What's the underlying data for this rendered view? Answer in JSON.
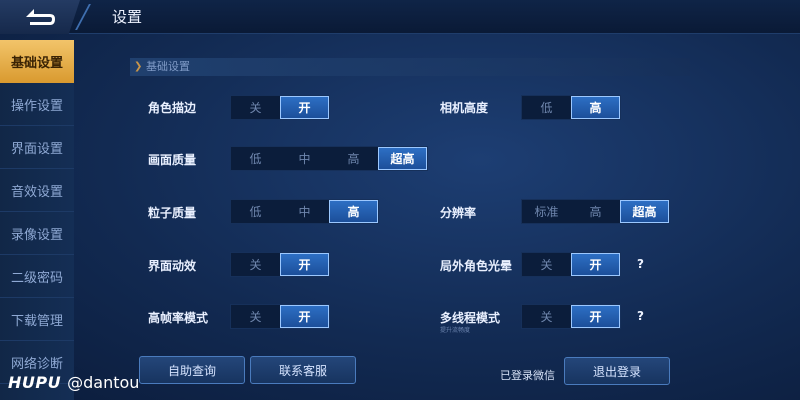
{
  "header": {
    "title": "设置"
  },
  "sidebar": {
    "items": [
      {
        "label": "基础设置",
        "active": true
      },
      {
        "label": "操作设置",
        "active": false
      },
      {
        "label": "界面设置",
        "active": false
      },
      {
        "label": "音效设置",
        "active": false
      },
      {
        "label": "录像设置",
        "active": false
      },
      {
        "label": "二级密码",
        "active": false
      },
      {
        "label": "下载管理",
        "active": false
      },
      {
        "label": "网络诊断",
        "active": false
      }
    ]
  },
  "section": {
    "title": "基础设置"
  },
  "settings": {
    "outline": {
      "label": "角色描边",
      "options": [
        "关",
        "开"
      ],
      "selected": "开"
    },
    "camera_height": {
      "label": "相机高度",
      "options": [
        "低",
        "高"
      ],
      "selected": "高"
    },
    "image_quality": {
      "label": "画面质量",
      "options": [
        "低",
        "中",
        "高",
        "超高"
      ],
      "selected": "超高"
    },
    "particle_quality": {
      "label": "粒子质量",
      "options": [
        "低",
        "中",
        "高"
      ],
      "selected": "高"
    },
    "resolution": {
      "label": "分辨率",
      "options": [
        "标准",
        "高",
        "超高"
      ],
      "selected": "超高"
    },
    "ui_animation": {
      "label": "界面动效",
      "options": [
        "关",
        "开"
      ],
      "selected": "开"
    },
    "outgame_glow": {
      "label": "局外角色光晕",
      "options": [
        "关",
        "开"
      ],
      "selected": "开",
      "help": "?"
    },
    "high_fps": {
      "label": "高帧率模式",
      "options": [
        "关",
        "开"
      ],
      "selected": "开"
    },
    "multithread": {
      "label": "多线程模式",
      "options": [
        "关",
        "开"
      ],
      "selected": "开",
      "help": "?",
      "sublabel": "提升流畅度"
    }
  },
  "footer": {
    "self_help_label": "自助查询",
    "contact_label": "联系客服",
    "login_status": "已登录微信",
    "logout_label": "退出登录"
  },
  "watermark": {
    "brand": "HUPU",
    "handle": "@dantou"
  },
  "colors": {
    "accent_active_tab": "#e0a83f",
    "selected_option": "#2d6fc4",
    "background": "#163563"
  }
}
